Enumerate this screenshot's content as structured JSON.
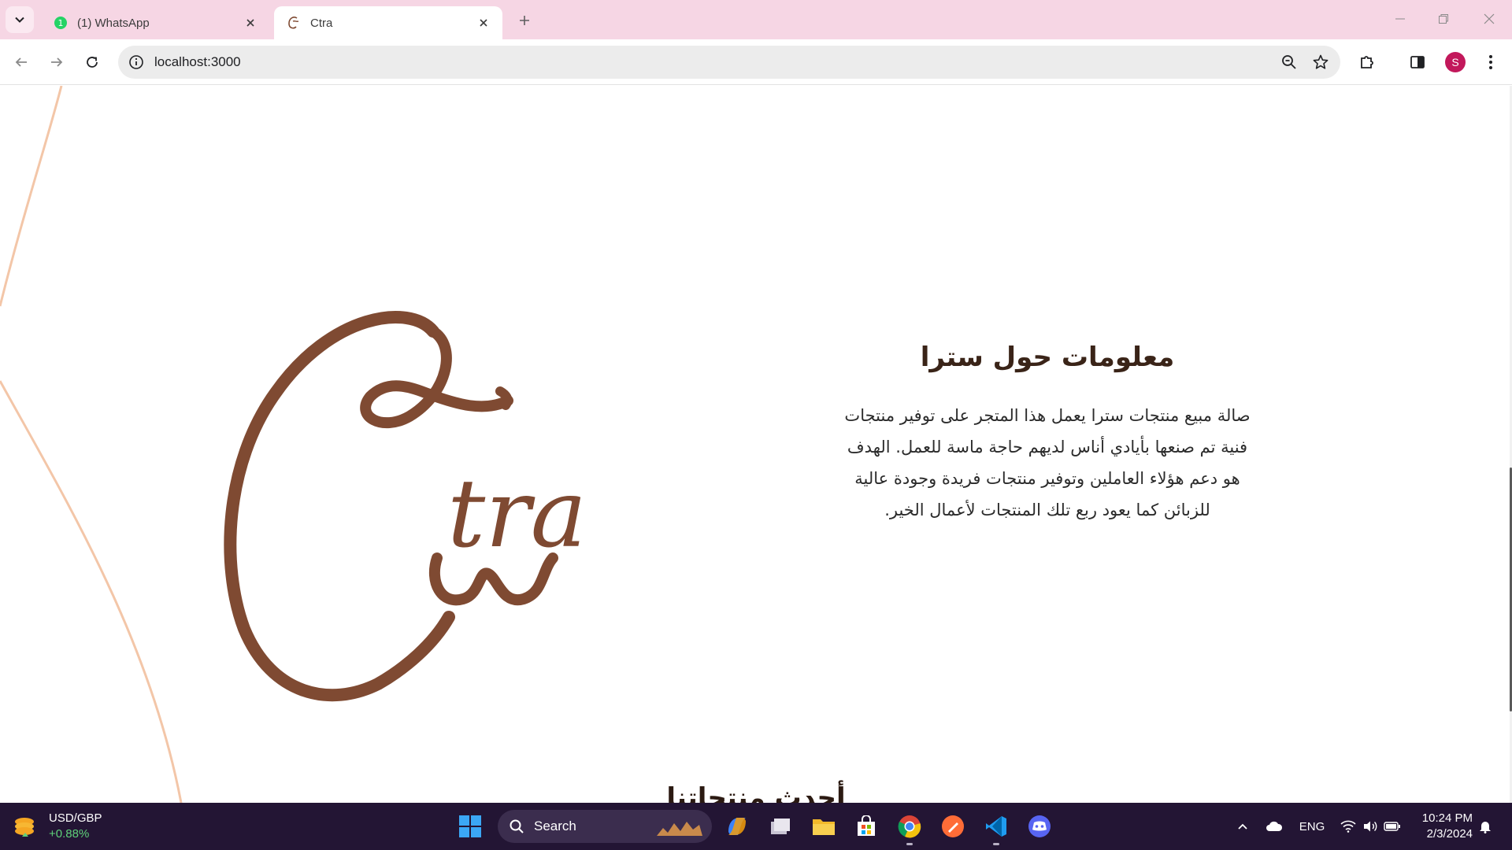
{
  "browser": {
    "tabs": [
      {
        "title": "(1) WhatsApp",
        "active": false,
        "badge": "1"
      },
      {
        "title": "Ctra",
        "active": true
      }
    ],
    "url": "localhost:3000",
    "profile_initial": "S",
    "accent_color": "#f6d6e4"
  },
  "page": {
    "logo_text": "tra",
    "about_title": "معلومات حول سترا",
    "about_lines": [
      "صالة مبيع منتجات سترا يعمل هذا المتجر على توفير منتجات",
      "فنية تم صنعها بأيادي أناس لديهم حاجة ماسة للعمل. الهدف",
      "هو دعم هؤلاء العاملين وتوفير منتجات فريدة وجودة عالية",
      "للزبائن كما يعود ربع تلك المنتجات لأعمال الخير."
    ],
    "next_section_title": "أحدث منتجاتنا",
    "brand_color": "#7f4a32",
    "curve_color": "#f3c6a8"
  },
  "taskbar": {
    "widget": {
      "symbol": "USD/GBP",
      "change": "+0.88%"
    },
    "search_label": "Search",
    "language": "ENG",
    "time": "10:24 PM",
    "date": "2/3/2024",
    "apps": [
      "copilot-icon",
      "task-view-icon",
      "file-explorer-icon",
      "microsoft-store-icon",
      "chrome-icon",
      "postman-icon",
      "vscode-icon",
      "discord-icon"
    ]
  }
}
